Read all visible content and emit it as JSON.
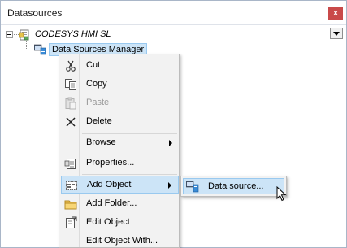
{
  "panel": {
    "title": "Datasources",
    "close_label": "x"
  },
  "tree": {
    "root": {
      "label": "CODESYS HMI SL",
      "icon": "project-icon"
    },
    "child": {
      "label": "Data Sources Manager",
      "icon": "data-sources-manager-icon"
    }
  },
  "context_menu": {
    "items": [
      {
        "label": "Cut",
        "icon": "scissors-icon"
      },
      {
        "label": "Copy",
        "icon": "copy-icon"
      },
      {
        "label": "Paste",
        "icon": "paste-icon",
        "disabled": true
      },
      {
        "label": "Delete",
        "icon": "delete-icon"
      },
      {
        "label": "Browse",
        "has_submenu": true
      },
      {
        "label": "Properties...",
        "icon": "properties-icon"
      },
      {
        "label": "Add Object",
        "icon": "add-object-icon",
        "has_submenu": true,
        "highlighted": true
      },
      {
        "label": "Add Folder...",
        "icon": "folder-icon"
      },
      {
        "label": "Edit Object",
        "icon": "edit-object-icon"
      },
      {
        "label": "Edit Object With..."
      }
    ]
  },
  "submenu": {
    "items": [
      {
        "label": "Data source...",
        "icon": "data-source-icon",
        "highlighted": true
      }
    ]
  },
  "colors": {
    "highlight_bg": "#cce4f7",
    "highlight_border": "#99c9ef",
    "menu_bg": "#f2f2f2",
    "close_bg": "#c94a4a"
  }
}
